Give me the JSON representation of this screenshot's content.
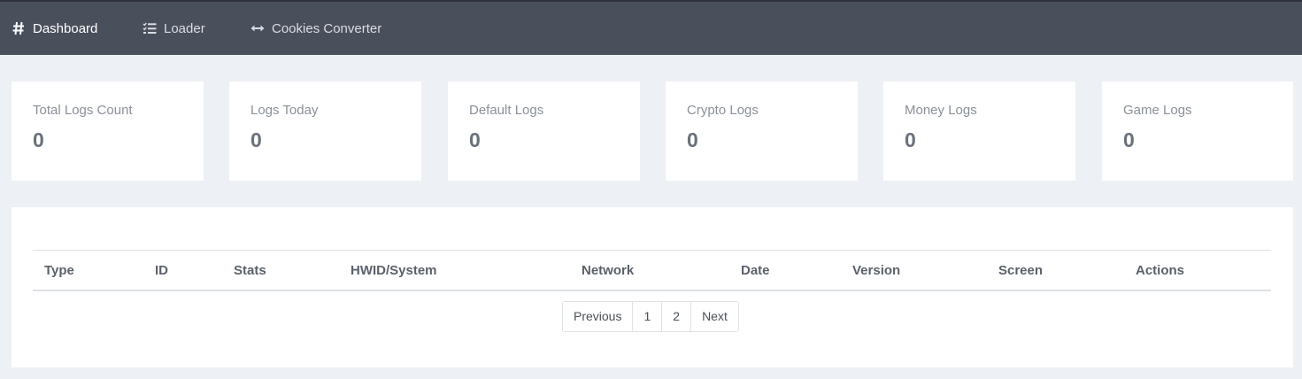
{
  "nav": {
    "items": [
      {
        "label": "Dashboard",
        "icon": "hash-icon",
        "active": true
      },
      {
        "label": "Loader",
        "icon": "list-check-icon",
        "active": false
      },
      {
        "label": "Cookies Converter",
        "icon": "arrows-left-right-icon",
        "active": false
      }
    ]
  },
  "stats": [
    {
      "label": "Total Logs Count",
      "value": "0"
    },
    {
      "label": "Logs Today",
      "value": "0"
    },
    {
      "label": "Default Logs",
      "value": "0"
    },
    {
      "label": "Crypto Logs",
      "value": "0"
    },
    {
      "label": "Money Logs",
      "value": "0"
    },
    {
      "label": "Game Logs",
      "value": "0"
    }
  ],
  "table": {
    "columns": [
      "Type",
      "ID",
      "Stats",
      "HWID/System",
      "Network",
      "Date",
      "Version",
      "Screen",
      "Actions"
    ],
    "rows": []
  },
  "pagination": {
    "previous": "Previous",
    "pages": [
      "1",
      "2"
    ],
    "next": "Next"
  },
  "colors": {
    "topbar": "#4a4f5c",
    "background": "#edf0f4",
    "card": "#ffffff"
  }
}
